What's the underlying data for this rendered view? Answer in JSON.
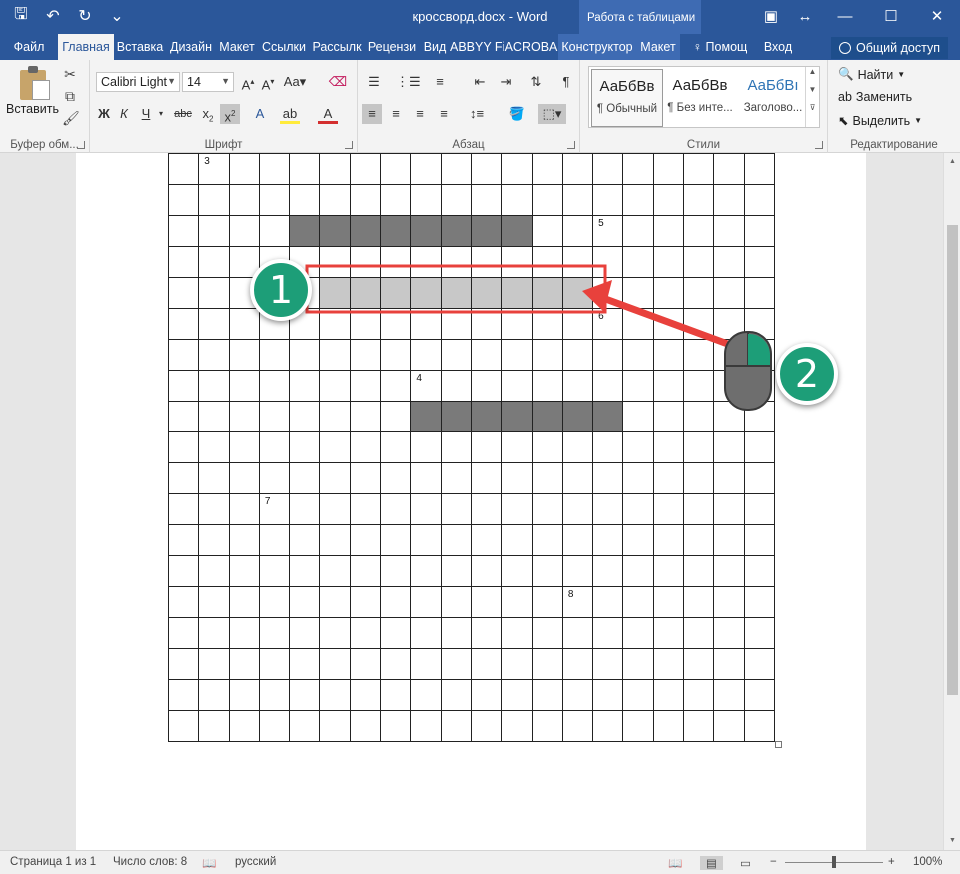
{
  "titlebar": {
    "doc_title": "кроссворд.docx - Word",
    "context_header": "Работа с таблицами",
    "qat": [
      {
        "name": "save-icon",
        "glyph": "🖫"
      },
      {
        "name": "undo-icon",
        "glyph": "↶"
      },
      {
        "name": "redo-icon",
        "glyph": "↻"
      },
      {
        "name": "customize-qat-icon",
        "glyph": "⌄"
      }
    ],
    "window_controls": [
      {
        "name": "ribbon-display-options-button",
        "glyph": "▣"
      },
      {
        "name": "restore-arrows-icon",
        "glyph": "↔"
      },
      {
        "name": "minimize-button",
        "glyph": "—"
      },
      {
        "name": "maximize-button",
        "glyph": "☐"
      },
      {
        "name": "close-button",
        "glyph": "✕"
      }
    ]
  },
  "tabs": [
    {
      "label": "Файл",
      "w": 58
    },
    {
      "label": "Главная",
      "w": 56,
      "active": true
    },
    {
      "label": "Вставка",
      "w": 52
    },
    {
      "label": "Дизайн",
      "w": 50
    },
    {
      "label": "Макет",
      "w": 42
    },
    {
      "label": "Ссылки",
      "w": 52
    },
    {
      "label": "Рассылк",
      "w": 54
    },
    {
      "label": "Рецензи",
      "w": 56
    },
    {
      "label": "Вид",
      "w": 30
    },
    {
      "label": "ABBYY Fi",
      "w": 54
    },
    {
      "label": "ACROBA",
      "w": 54
    },
    {
      "label": "Конструктор",
      "w": 78,
      "ctx": true
    },
    {
      "label": "Макет",
      "w": 44,
      "ctx": true
    },
    {
      "label": "♀ Помощ",
      "w": 80
    },
    {
      "label": "Вход",
      "w": 36
    }
  ],
  "share_label": "Общий доступ",
  "ribbon": {
    "clipboard": {
      "label": "Буфер обм...",
      "paste": "Вставить"
    },
    "font": {
      "label": "Шрифт",
      "font_name": "Calibri Light",
      "font_size": "14"
    },
    "paragraph": {
      "label": "Абзац"
    },
    "styles": {
      "label": "Стили",
      "items": [
        {
          "sample": "АаБбВв",
          "name": "¶ Обычный"
        },
        {
          "sample": "АаБбВв",
          "name": "¶ Без инте..."
        },
        {
          "sample": "АаБбВı",
          "name": "Заголово..."
        }
      ]
    },
    "editing": {
      "label": "Редактирование",
      "find": "Найти",
      "replace": "Заменить",
      "select": "Выделить"
    }
  },
  "crossword": {
    "rows": 19,
    "cols": 20,
    "numbers": [
      {
        "row": 0,
        "col": 1,
        "n": "3"
      },
      {
        "row": 2,
        "col": 14,
        "n": "5"
      },
      {
        "row": 5,
        "col": 14,
        "n": "6"
      },
      {
        "row": 7,
        "col": 8,
        "n": "4"
      },
      {
        "row": 11,
        "col": 3,
        "n": "7"
      },
      {
        "row": 14,
        "col": 13,
        "n": "8"
      }
    ],
    "dark_cells": [
      {
        "row": 2,
        "cols": [
          4,
          5,
          6,
          7,
          8,
          9,
          10,
          11
        ]
      },
      {
        "row": 8,
        "cols": [
          8,
          9,
          10,
          11,
          12,
          13,
          14
        ]
      }
    ],
    "selected_cells": [
      {
        "row": 4,
        "cols": [
          5,
          6,
          7,
          8,
          9,
          10,
          11,
          12,
          13
        ]
      }
    ]
  },
  "annotations": {
    "step1": "1",
    "step2": "2",
    "accent_color": "#1d9e78",
    "highlight_color": "#e8413c"
  },
  "statusbar": {
    "page": "Страница 1 из 1",
    "words": "Число слов: 8",
    "language": "русский",
    "zoom": "100%"
  }
}
